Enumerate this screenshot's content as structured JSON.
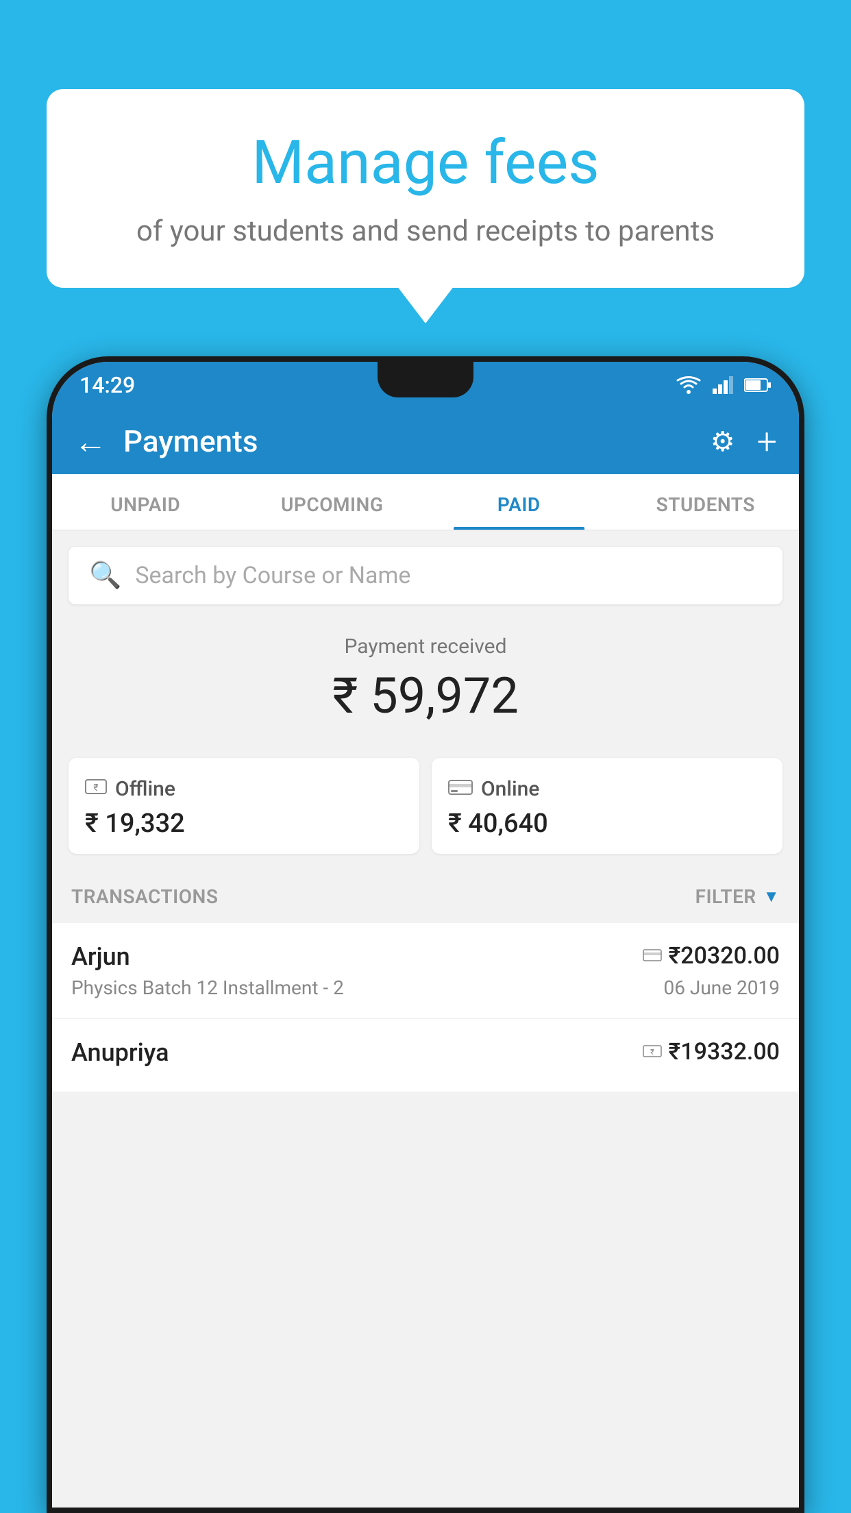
{
  "background_color": "#29b6e8",
  "speech_bubble": {
    "title": "Manage fees",
    "subtitle": "of your students and send receipts to parents"
  },
  "status_bar": {
    "time": "14:29"
  },
  "header": {
    "title": "Payments",
    "back_label": "←",
    "settings_label": "⚙",
    "add_label": "+"
  },
  "tabs": [
    {
      "label": "UNPAID",
      "active": false
    },
    {
      "label": "UPCOMING",
      "active": false
    },
    {
      "label": "PAID",
      "active": true
    },
    {
      "label": "STUDENTS",
      "active": false
    }
  ],
  "search": {
    "placeholder": "Search by Course or Name"
  },
  "payment_received": {
    "label": "Payment received",
    "amount": "₹ 59,972",
    "offline_label": "Offline",
    "offline_amount": "₹ 19,332",
    "online_label": "Online",
    "online_amount": "₹ 40,640"
  },
  "transactions": {
    "header_label": "TRANSACTIONS",
    "filter_label": "FILTER",
    "rows": [
      {
        "name": "Arjun",
        "amount": "₹20320.00",
        "course": "Physics Batch 12 Installment - 2",
        "date": "06 June 2019",
        "payment_type": "card"
      },
      {
        "name": "Anupriya",
        "amount": "₹19332.00",
        "course": "",
        "date": "",
        "payment_type": "offline"
      }
    ]
  }
}
